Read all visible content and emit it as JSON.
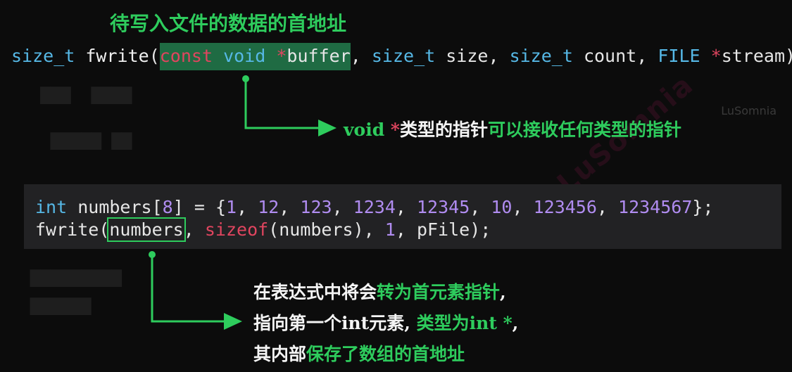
{
  "title": "待写入文件的数据的首地址",
  "watermark": "LuSomnia",
  "prototype": {
    "ret_type": "size_t",
    "func": "fwrite",
    "lparen": "(",
    "kw_const": "const",
    "kw_void": "void",
    "star1": "*",
    "p_buffer": "buffer",
    "comma1": ",",
    "t_size1": "size_t",
    "p_size": "size",
    "comma2": ",",
    "t_size2": "size_t",
    "p_count": "count",
    "comma3": ",",
    "t_file": "FILE",
    "star2": "*",
    "p_stream": "stream",
    "tail": ");"
  },
  "note_void": {
    "kw": "void",
    "star": "*",
    "part1": "类型的指针",
    "part2": "可以接收任何类型的指针"
  },
  "code": {
    "kw_int": "int",
    "arr_name": "numbers",
    "lbr": "[",
    "size": "8",
    "rbr": "]",
    "eq": "=",
    "lbrace": "{",
    "values": [
      "1",
      "12",
      "123",
      "1234",
      "12345",
      "10",
      "123456",
      "1234567"
    ],
    "rbrace_semi": "};",
    "call_func": "fwrite",
    "lparen": "(",
    "arg1": "numbers",
    "comma": ",",
    "kw_sizeof": "sizeof",
    "sizeof_arg": "(numbers)",
    "comma2": ",",
    "arg3": "1",
    "comma3": ",",
    "arg4": "pFile",
    "tail": ");"
  },
  "note_array": {
    "l1_a": "在表达式中将会",
    "l1_b": "转为首元素指针",
    "l1_c": ",",
    "l2_a": "指向第一个int元素,",
    "l2_b": "类型为int *",
    "l2_c": ",",
    "l3_a": "其内部",
    "l3_b": "保存了数组的首地址"
  },
  "colors": {
    "accent_green": "#2ecc5d",
    "highlight_green": "#1f6b43",
    "type_blue": "#56b8e6",
    "keyword_red": "#e0455f",
    "number_purple": "#b08cf0",
    "code_bg": "#222224",
    "page_bg": "#0c0c0c"
  }
}
